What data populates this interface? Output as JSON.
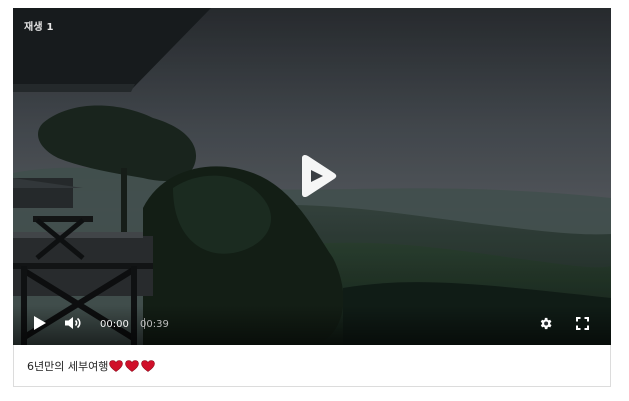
{
  "video": {
    "play_count_label": "재생 1",
    "current_time": "00:00",
    "duration": "00:39"
  },
  "caption": {
    "text": "6년만의 세부여행",
    "emoji": [
      "heart-icon",
      "heart-icon",
      "heart-icon"
    ]
  },
  "colors": {
    "heart": "#d0102a",
    "controls": "#ffffff",
    "border": "#dcdcdc"
  }
}
